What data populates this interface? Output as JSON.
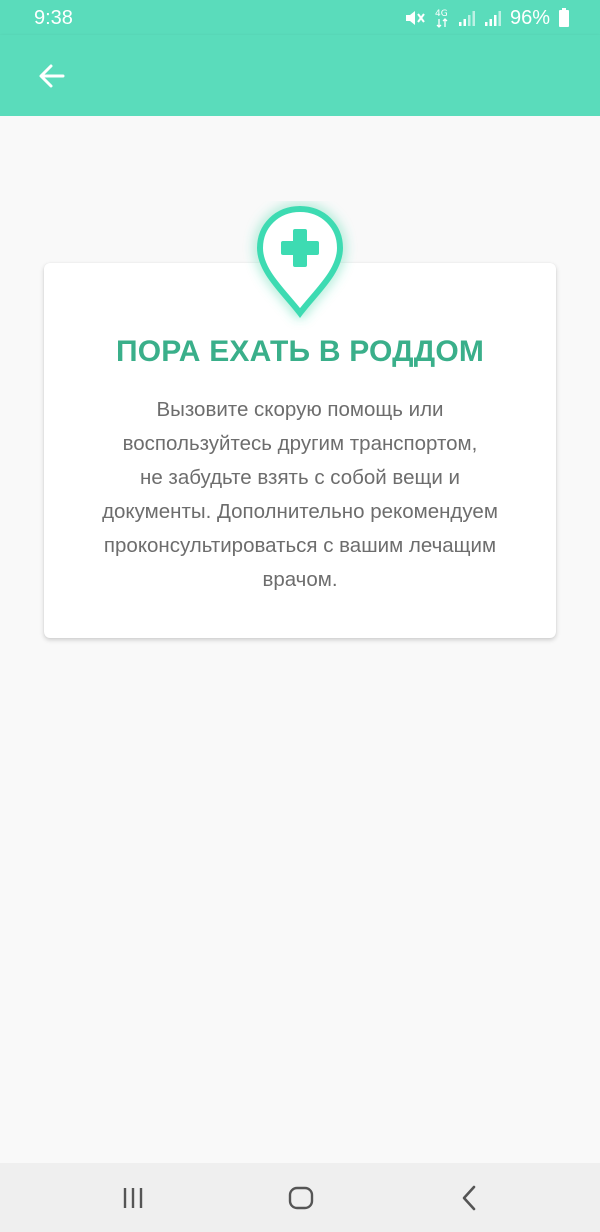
{
  "status_bar": {
    "time": "9:38",
    "battery_percent": "96%",
    "network_type": "4G",
    "icons": [
      "mute-icon",
      "4g-data-icon",
      "signal-icon",
      "signal-icon",
      "battery-icon"
    ]
  },
  "toolbar": {
    "back_icon": "arrow-left-icon"
  },
  "card": {
    "icon": "medical-location-pin-icon",
    "title": "ПОРА ЕХАТЬ В РОДДОМ",
    "lines": [
      "Вызовите скорую помощь или",
      "воспользуйтесь другим транспортом,",
      "не забудьте взять с собой вещи и",
      "документы. Дополнительно рекомендуем",
      "проконсультироваться с вашим лечащим",
      "врачом."
    ]
  },
  "nav_bar": {
    "icons": [
      "recent-apps-icon",
      "home-icon",
      "back-icon"
    ]
  },
  "colors": {
    "accent": "#5adcbb",
    "title": "#3aaf8a",
    "text": "#6d6d6d",
    "background": "#f9f9f9"
  }
}
